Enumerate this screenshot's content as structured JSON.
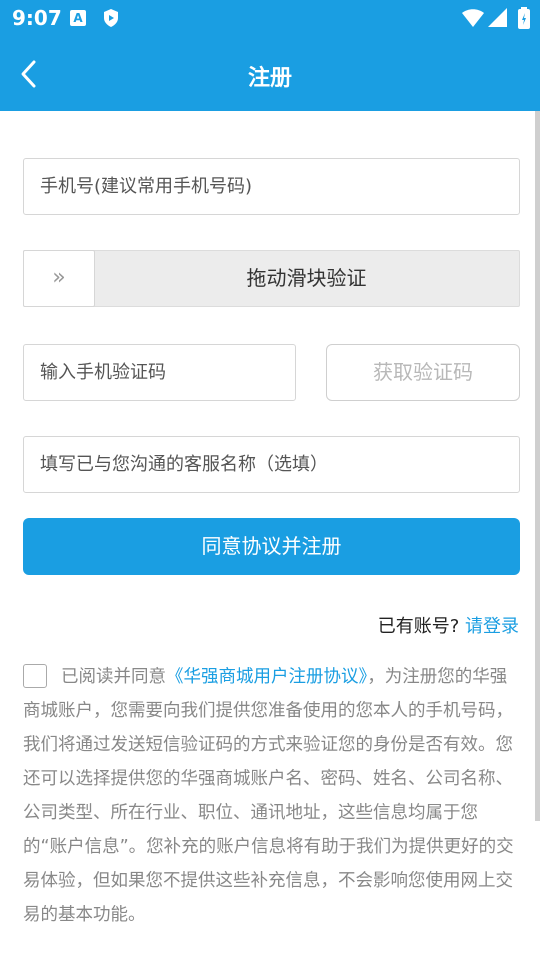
{
  "status_bar": {
    "time": "9:07",
    "app_icon_letter": "A"
  },
  "header": {
    "title": "注册"
  },
  "form": {
    "phone_placeholder": "手机号(建议常用手机号码)",
    "slider_handle": "»",
    "slider_label": "拖动滑块验证",
    "code_placeholder": "输入手机验证码",
    "get_code_label": "获取验证码",
    "service_placeholder": "填写已与您沟通的客服名称（选填）",
    "submit_label": "同意协议并注册"
  },
  "login": {
    "prompt": "已有账号?",
    "link": "请登录"
  },
  "agreement": {
    "prefix": "已阅读并同意",
    "protocol_link": "《华强商城用户注册协议》",
    "body": "，为注册您的华强商城账户，您需要向我们提供您准备使用的您本人的手机号码，我们将通过发送短信验证码的方式来验证您的身份是否有效。您还可以选择提供您的华强商城账户名、密码、姓名、公司名称、公司类型、所在行业、职位、通讯地址，这些信息均属于您的“账户信息”。您补充的账户信息将有助于我们为提供更好的交易体验，但如果您不提供这些补充信息，不会影响您使用网上交易的基本功能。",
    "checked": false
  },
  "colors": {
    "primary": "#1a9ee2",
    "text_muted": "#888888"
  }
}
